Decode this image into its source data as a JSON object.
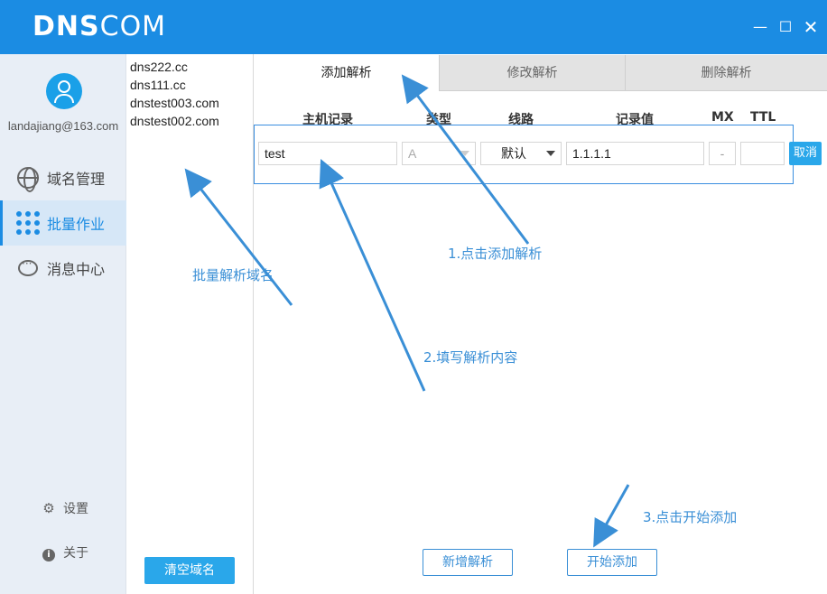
{
  "app": {
    "logo_bold": "DNS",
    "logo_light": "COM",
    "window": {
      "minimize": "—",
      "maximize": "☐",
      "close": "✕"
    }
  },
  "sidebar": {
    "email": "landajiang@163.com",
    "nav": [
      {
        "label": "域名管理",
        "icon": "globe-icon"
      },
      {
        "label": "批量作业",
        "icon": "grid-dots-icon",
        "active": true
      },
      {
        "label": "消息中心",
        "icon": "chat-bubble-icon"
      }
    ],
    "settings": "设置",
    "about": "关于"
  },
  "domains": {
    "items": [
      "dns222.cc",
      "dns111.cc",
      "dnstest003.com",
      "dnstest002.com"
    ],
    "clear_button": "清空域名"
  },
  "tabs": {
    "add": "添加解析",
    "edit": "修改解析",
    "delete": "删除解析",
    "active": "add"
  },
  "form": {
    "headers": {
      "host": "主机记录",
      "type": "类型",
      "line": "线路",
      "value": "记录值",
      "mx": "MX",
      "ttl": "TTL"
    },
    "row": {
      "host": "test",
      "type": "A",
      "line": "默认",
      "value": "1.1.1.1",
      "mx": "-",
      "ttl": ""
    },
    "cancel": "取消"
  },
  "annotations": {
    "step1": "1.点击添加解析",
    "step2": "2.填写解析内容",
    "step3": "3.点击开始添加",
    "batch": "批量解析域名"
  },
  "actions": {
    "new": "新增解析",
    "start": "开始添加"
  },
  "colors": {
    "brand": "#1b8ce3",
    "button": "#2aa7ea",
    "annotation": "#3a8fd6"
  }
}
